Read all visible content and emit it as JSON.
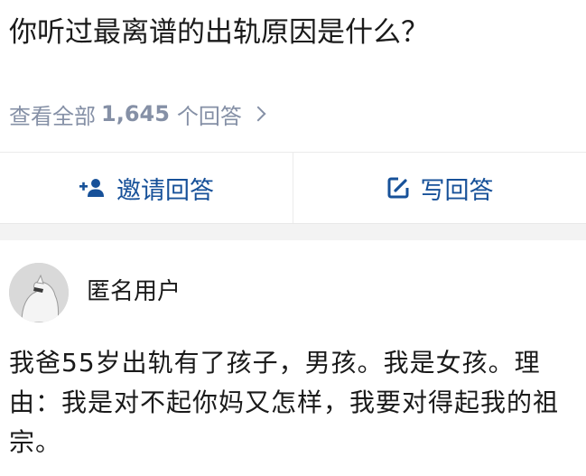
{
  "question": {
    "title": "你听过最离谱的出轨原因是什么？"
  },
  "view_all": {
    "prefix": "查看全部",
    "count": "1,645",
    "suffix": "个回答"
  },
  "actions": {
    "invite_label": "邀请回答",
    "write_label": "写回答"
  },
  "answer": {
    "author": "匿名用户",
    "text": "我爸55岁出轨有了孩子，男孩。我是女孩。理由：我是对不起你妈又怎样，我要对得起我的祖宗。"
  },
  "colors": {
    "link_blue": "#175199",
    "meta_gray": "#8590a6",
    "text": "#1a1a1a",
    "band": "#f3f3f3"
  }
}
